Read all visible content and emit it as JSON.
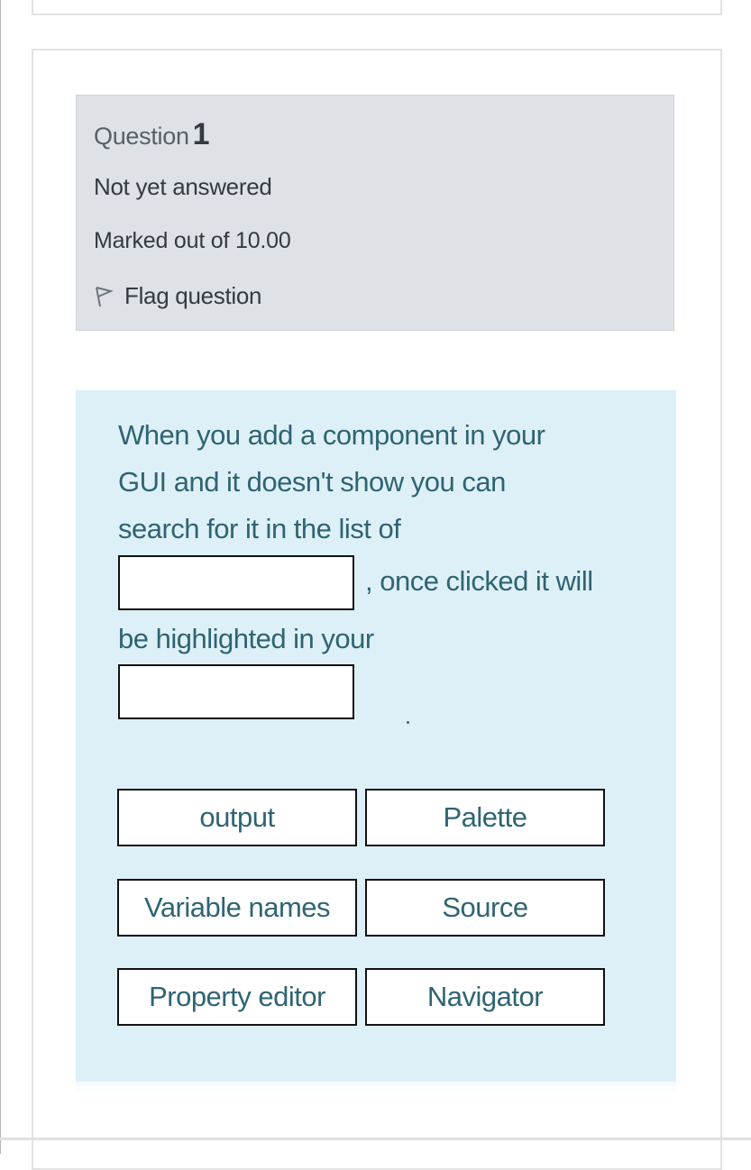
{
  "question_info": {
    "question_label": "Question",
    "question_number": "1",
    "state": "Not yet answered",
    "grade": "Marked out of 10.00",
    "flag_label": "Flag question",
    "flag_icon": "flag-outline-icon"
  },
  "question": {
    "lines": [
      "When you add a component in your",
      "GUI and it doesn't show you can",
      "search for it in the list of",
      ", once clicked it will",
      "be highlighted in your",
      "."
    ],
    "drop_zones": [
      {
        "value": ""
      },
      {
        "value": ""
      }
    ],
    "choices": [
      "output",
      "Palette",
      "Variable names",
      "Source",
      "Property editor",
      "Navigator"
    ]
  },
  "colors": {
    "info_bg": "#dee2e6",
    "content_bg": "#def0f7",
    "content_text": "#2f6473",
    "info_text": "#343a40"
  }
}
